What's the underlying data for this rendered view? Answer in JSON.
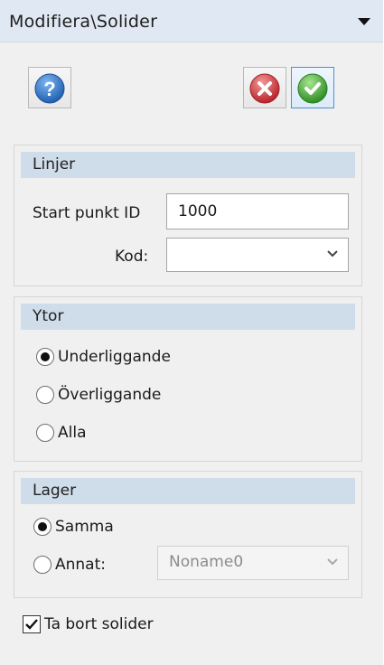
{
  "panel": {
    "title": "Modifiera\\Solider",
    "toolbar": {
      "help_icon": "help-icon",
      "cancel_icon": "cancel-icon",
      "ok_icon": "checkmark-icon"
    }
  },
  "linjer": {
    "header": "Linjer",
    "start_label": "Start punkt ID",
    "start_value": "1000",
    "kod_label": "Kod:",
    "kod_value": ""
  },
  "ytor": {
    "header": "Ytor",
    "options": [
      {
        "label": "Underliggande",
        "selected": true
      },
      {
        "label": "Överliggande",
        "selected": false
      },
      {
        "label": "Alla",
        "selected": false
      }
    ]
  },
  "lager": {
    "header": "Lager",
    "samma_label": "Samma",
    "samma_selected": true,
    "annat_label": "Annat:",
    "annat_selected": false,
    "annat_value": "Noname0"
  },
  "remove": {
    "label": "Ta bort solider",
    "checked": true
  },
  "colors": {
    "title_bg": "#dfe8f3",
    "group_header_bg": "#cfdcea",
    "ok_border": "#4f8fd6",
    "help_blue": "#2f74c6",
    "cancel_red": "#d8454a",
    "ok_green": "#4cae3c"
  }
}
